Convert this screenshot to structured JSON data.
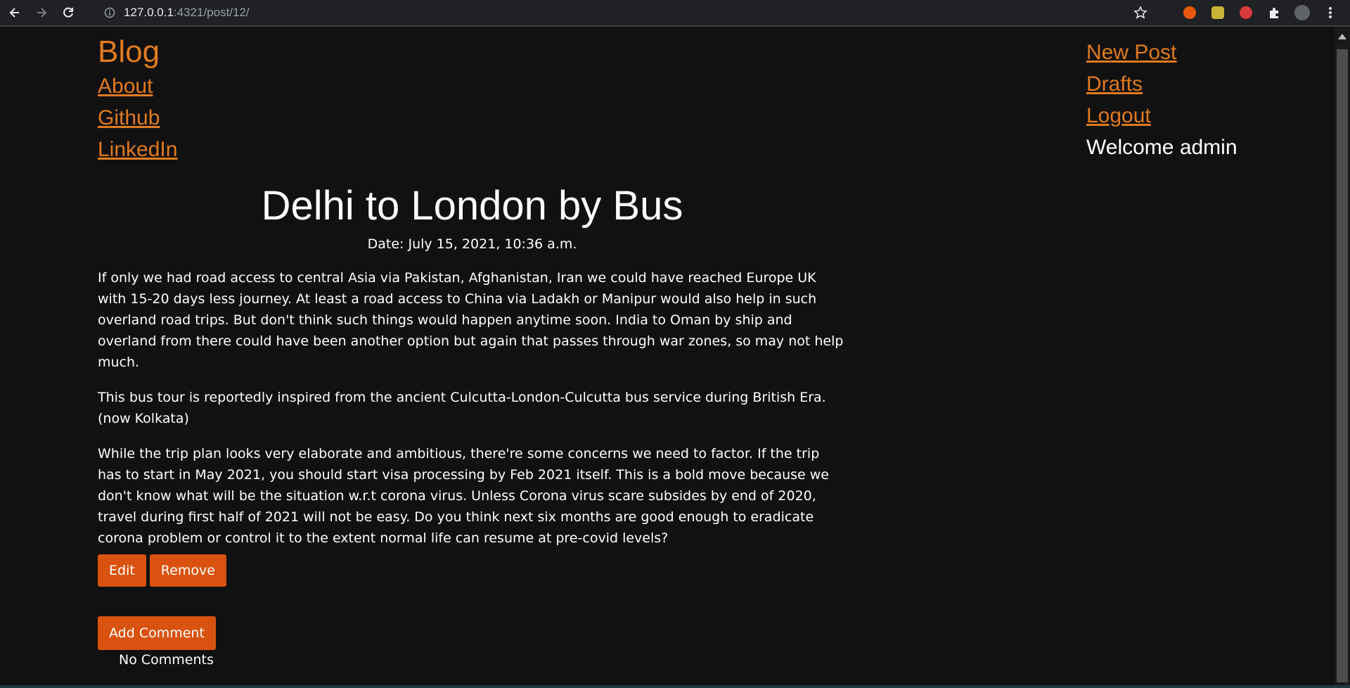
{
  "browser": {
    "url_host": "127.0.0.1",
    "url_rest": ":4321/post/12/"
  },
  "nav": {
    "brand": "Blog",
    "left_links": [
      "About",
      "Github",
      "LinkedIn"
    ],
    "right_links": [
      "New Post",
      "Drafts",
      "Logout"
    ],
    "welcome": "Welcome admin"
  },
  "post": {
    "title": "Delhi to London by Bus",
    "date": "Date: July 15, 2021, 10:36 a.m.",
    "paragraphs": [
      "If only we had road access to central Asia via Pakistan, Afghanistan, Iran we could have reached Europe UK with 15-20 days less journey. At least a road access to China via Ladakh or Manipur would also help in such overland road trips. But don't think such things would happen anytime soon. India to Oman by ship and overland from there could have been another option but again that passes through war zones, so may not help much.",
      "This bus tour is reportedly inspired from the ancient Culcutta-London-Culcutta bus service during British Era. (now Kolkata)",
      "While the trip plan looks very elaborate and ambitious, there're some concerns we need to factor. If the trip has to start in May 2021, you should start visa processing by Feb 2021 itself. This is a bold move because we don't know what will be the situation w.r.t corona virus. Unless Corona virus scare subsides by end of 2020, travel during first half of 2021 will not be easy. Do you think next six months are good enough to eradicate corona problem or control it to the extent normal life can resume at pre-covid levels?"
    ],
    "edit_label": "Edit",
    "remove_label": "Remove"
  },
  "comments": {
    "add_label": "Add Comment",
    "empty_text": "No Comments"
  },
  "colors": {
    "link": "#e07a1f",
    "button": "#d9520f",
    "background": "#111111"
  }
}
